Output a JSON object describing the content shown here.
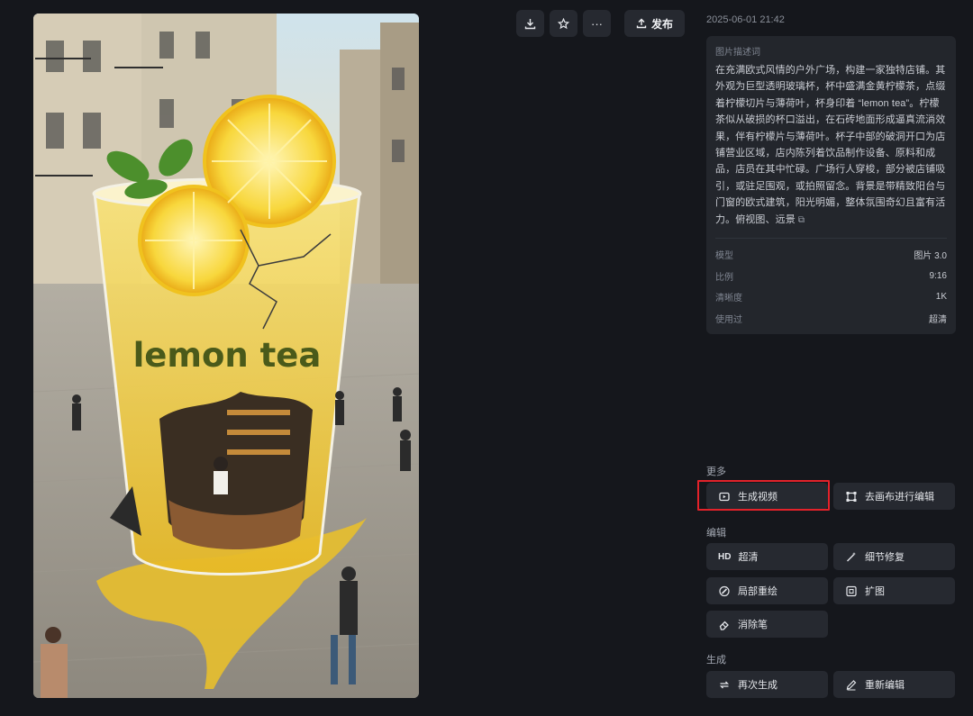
{
  "toolbar": {
    "download_icon": "download-icon",
    "favorite_icon": "star-icon",
    "more_icon": "more-icon",
    "more_glyph": "···",
    "publish_label": "发布"
  },
  "image": {
    "cup_text": "lemon tea"
  },
  "info": {
    "timestamp": "2025-06-01 21:42",
    "prompt_label": "图片描述词",
    "prompt_text": "在充满欧式风情的户外广场，构建一家独特店铺。其外观为巨型透明玻璃杯，杯中盛满金黄柠檬茶，点缀着柠檬切片与薄荷叶，杯身印着 “lemon tea”。柠檬茶似从破损的杯口溢出，在石砖地面形成逼真流淌效果，伴有柠檬片与薄荷叶。杯子中部的破洞开口为店铺营业区域，店内陈列着饮品制作设备、原料和成品，店员在其中忙碌。广场行人穿梭，部分被店铺吸引，或驻足围观，或拍照留念。背景是带精致阳台与门窗的欧式建筑，阳光明媚，整体氛围奇幻且富有活力。俯视图、远景",
    "copy_glyph": "⧉",
    "meta": [
      {
        "key": "模型",
        "value": "图片 3.0"
      },
      {
        "key": "比例",
        "value": "9:16"
      },
      {
        "key": "清晰度",
        "value": "1K"
      },
      {
        "key": "使用过",
        "value": "超清"
      }
    ]
  },
  "sections": {
    "more": "更多",
    "edit": "编辑",
    "generate": "生成"
  },
  "actions": {
    "generate_video": {
      "label": "生成视频",
      "icon": "video-icon"
    },
    "canvas_edit": {
      "label": "去画布进行编辑",
      "icon": "canvas-icon"
    },
    "hd": {
      "label": "超清",
      "icon_text": "HD"
    },
    "detail_fix": {
      "label": "细节修复",
      "icon": "magic-wand-icon"
    },
    "inpaint": {
      "label": "局部重绘",
      "icon": "brush-icon"
    },
    "expand": {
      "label": "扩图",
      "icon": "expand-icon"
    },
    "eraser": {
      "label": "消除笔",
      "icon": "eraser-icon"
    },
    "regenerate": {
      "label": "再次生成",
      "icon": "repeat-icon"
    },
    "reedit": {
      "label": "重新编辑",
      "icon": "pencil-icon"
    }
  },
  "colors": {
    "background": "#15171c",
    "panel": "#23262c",
    "button": "#262930",
    "highlight": "#e3222a",
    "tea": "#f2cf3a"
  }
}
